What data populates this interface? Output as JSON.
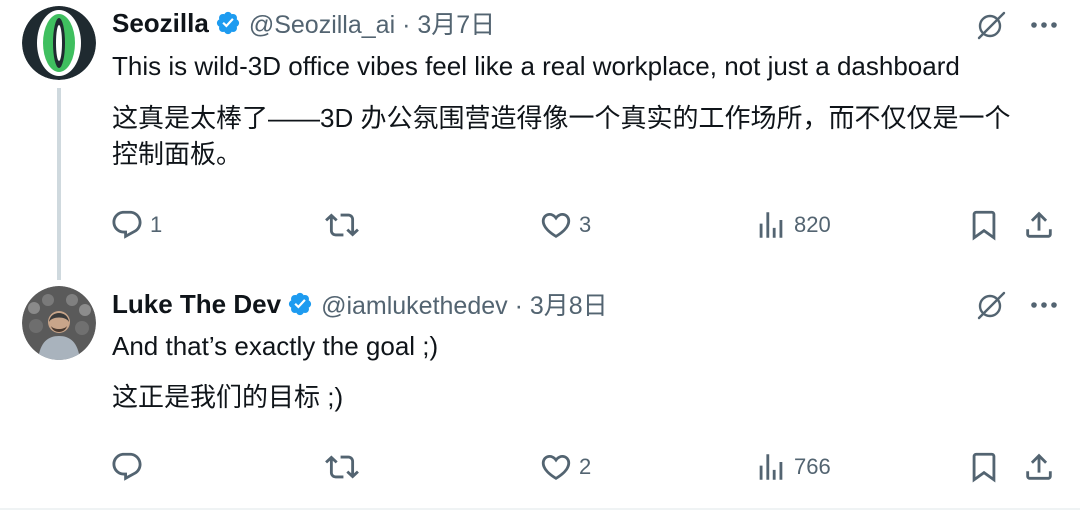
{
  "tweets": [
    {
      "author_name": "Seozilla",
      "handle_date": "@Seozilla_ai · 3月7日",
      "lines": [
        "This is wild-3D office vibes feel like a real workplace, not just a dashboard",
        "这真是太棒了——3D 办公氛围营造得像一个真实的工作场所，而不仅仅是一个",
        "控制面板。"
      ],
      "replies": "1",
      "retweets": "",
      "likes": "3",
      "views": "820"
    },
    {
      "author_name": "Luke The Dev",
      "handle_date": "@iamlukethedev · 3月8日",
      "lines": [
        "And that’s exactly the goal ;)",
        "这正是我们的目标 ;)"
      ],
      "replies": "",
      "retweets": "",
      "likes": "2",
      "views": "766"
    }
  ],
  "colors": {
    "verified": "#1d9bf0",
    "text": "#0f1419",
    "muted": "#536471",
    "thread_line": "#cfd9de"
  },
  "icons": [
    "verified-badge-icon",
    "grok-translate-icon",
    "more-icon",
    "reply-icon",
    "retweet-icon",
    "like-icon",
    "views-icon",
    "bookmark-icon",
    "share-icon"
  ]
}
